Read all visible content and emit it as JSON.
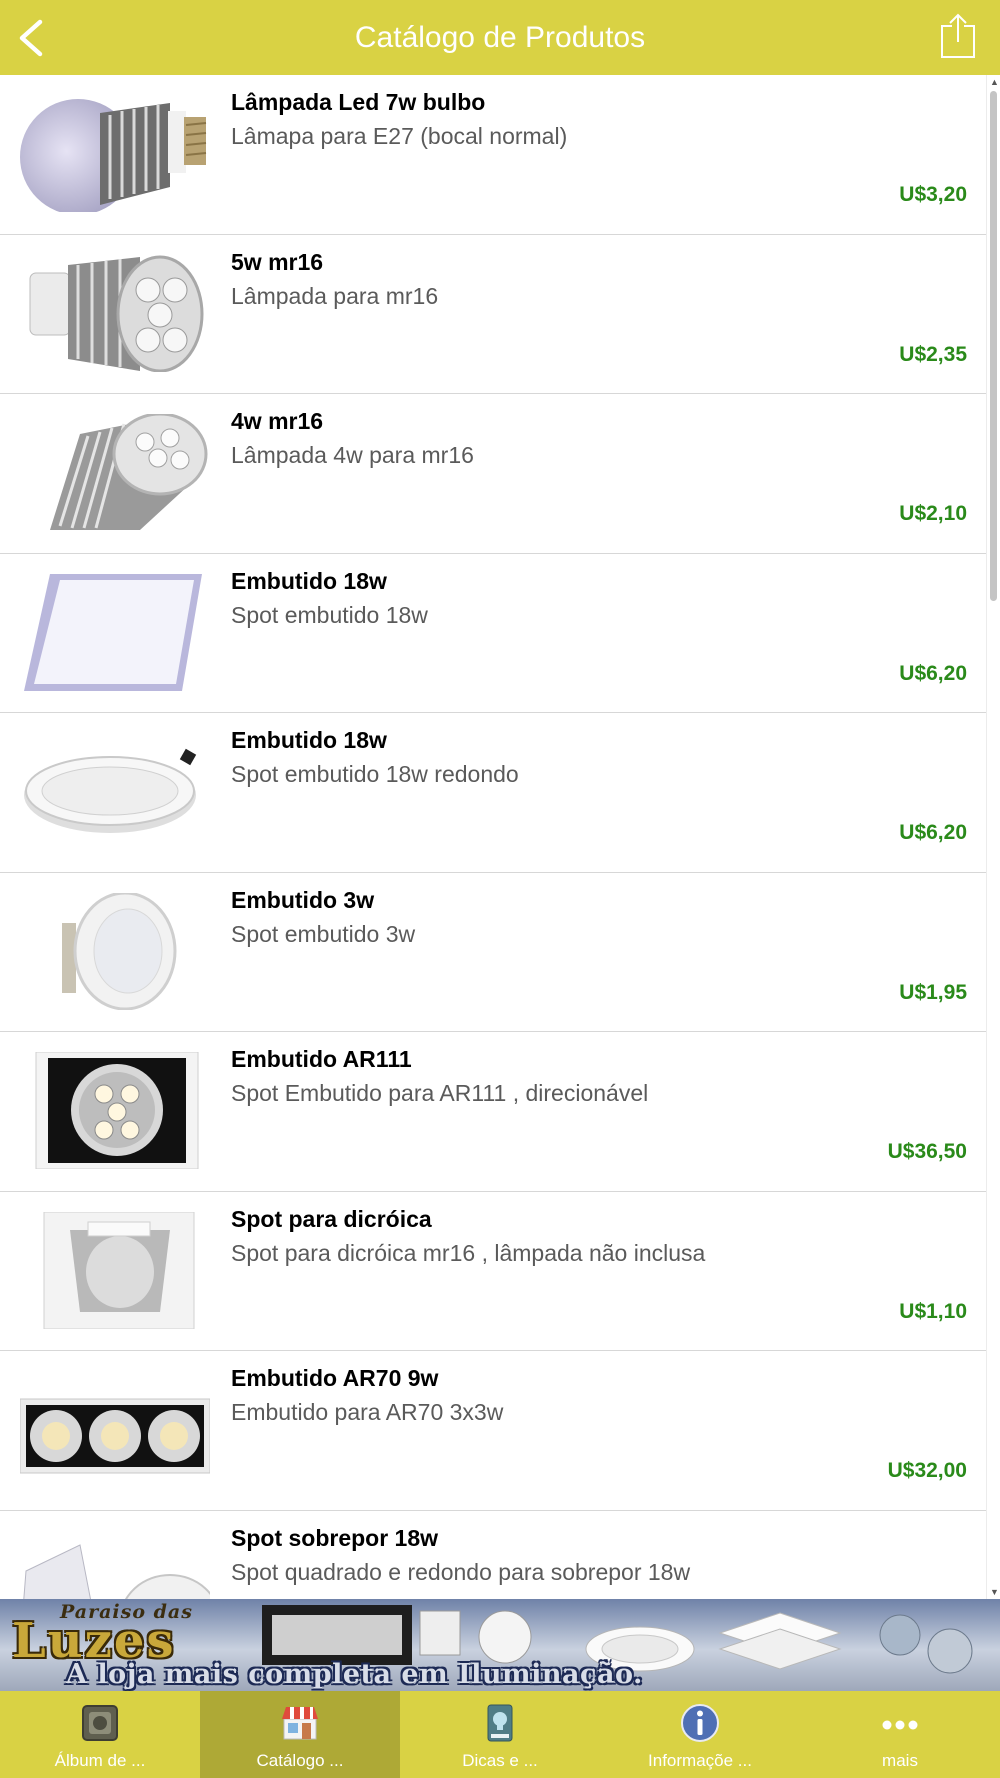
{
  "header": {
    "title": "Catálogo de Produtos"
  },
  "products": [
    {
      "name": "Lâmpada Led 7w bulbo",
      "desc": "Lâmapa para E27 (bocal normal)",
      "price": "U$3,20"
    },
    {
      "name": "5w mr16",
      "desc": "Lâmpada para mr16",
      "price": "U$2,35"
    },
    {
      "name": "4w mr16",
      "desc": "Lâmpada 4w para mr16",
      "price": "U$2,10"
    },
    {
      "name": "Embutido 18w",
      "desc": "Spot embutido 18w",
      "price": "U$6,20"
    },
    {
      "name": "Embutido 18w",
      "desc": "Spot embutido 18w redondo",
      "price": "U$6,20"
    },
    {
      "name": "Embutido 3w",
      "desc": "Spot embutido 3w",
      "price": "U$1,95"
    },
    {
      "name": "Embutido AR111",
      "desc": "Spot Embutido para AR111 , direcionável",
      "price": "U$36,50"
    },
    {
      "name": "Spot para dicróica",
      "desc": "Spot para dicróica mr16 , lâmpada não inclusa",
      "price": "U$1,10"
    },
    {
      "name": "Embutido AR70 9w",
      "desc": "Embutido para AR70 3x3w",
      "price": "U$32,00"
    },
    {
      "name": "Spot sobrepor 18w",
      "desc": "Spot quadrado e redondo para sobrepor 18w",
      "price": ""
    }
  ],
  "banner": {
    "brand_top": "Paraiso das",
    "brand": "Luzes",
    "slogan": "A loja mais completa em Iluminação."
  },
  "tabs": [
    {
      "label": "Álbum de ...",
      "icon": "photo-album-icon"
    },
    {
      "label": "Catálogo ...",
      "icon": "storefront-icon"
    },
    {
      "label": "Dicas e ...",
      "icon": "lightbulb-tips-icon"
    },
    {
      "label": "Informaçõe ...",
      "icon": "info-icon"
    },
    {
      "label": "mais",
      "icon": "more-dots-icon"
    }
  ],
  "colors": {
    "accent": "#d9d244",
    "active_tab": "#aea936",
    "price": "#2a8a1a"
  }
}
